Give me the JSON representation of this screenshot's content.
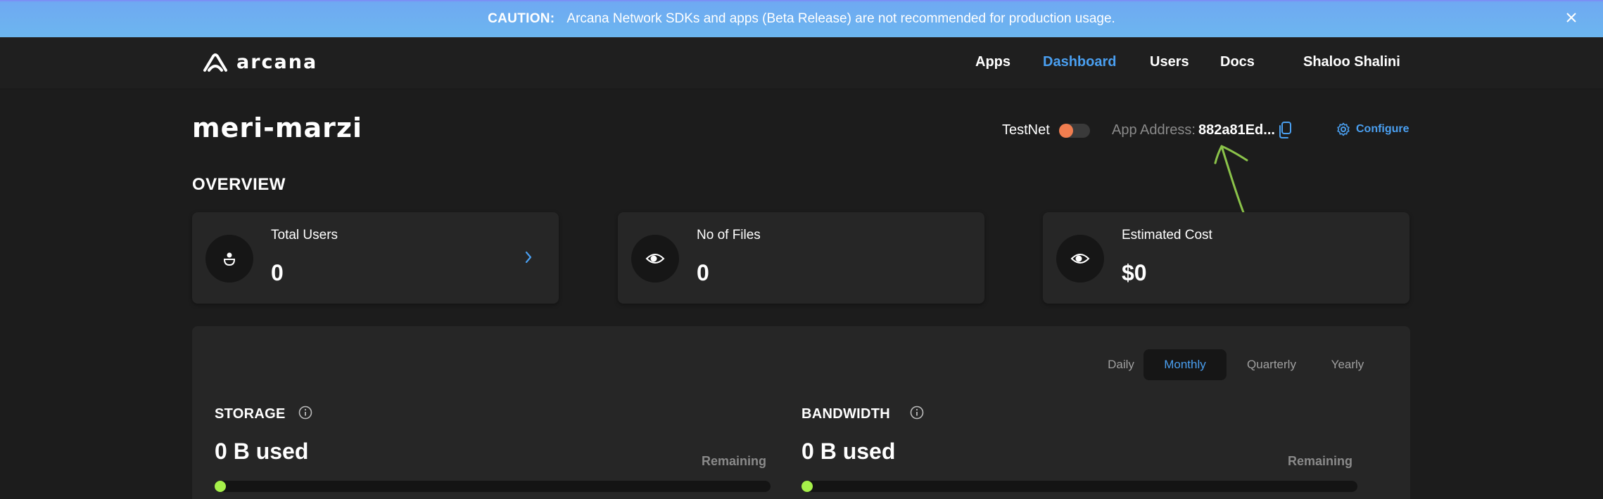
{
  "banner": {
    "caution_label": "CAUTION:",
    "message": "Arcana Network SDKs and apps (Beta Release) are not recommended for production usage."
  },
  "header": {
    "logo_text": "arcana",
    "nav": [
      "Apps",
      "Dashboard",
      "Users",
      "Docs"
    ],
    "active_nav": "Dashboard",
    "user_name": "Shaloo Shalini"
  },
  "app": {
    "title": "meri-marzi",
    "network_label": "TestNet",
    "network_toggle_on": false,
    "address_label": "App Address:",
    "address_value": "882a81Ed...",
    "configure_label": "Configure"
  },
  "overview": {
    "title": "OVERVIEW",
    "cards": [
      {
        "label": "Total Users",
        "value": "0",
        "icon": "user-icon"
      },
      {
        "label": "No of Files",
        "value": "0",
        "icon": "eye-icon"
      },
      {
        "label": "Estimated Cost",
        "value": "$0",
        "icon": "eye-icon"
      }
    ]
  },
  "usage": {
    "periods": [
      "Daily",
      "Monthly",
      "Quarterly",
      "Yearly"
    ],
    "active_period": "Monthly",
    "storage": {
      "title": "STORAGE",
      "used": "0 B used",
      "remaining_label": "Remaining",
      "fill_fraction": 0
    },
    "bandwidth": {
      "title": "BANDWIDTH",
      "used": "0 B used",
      "remaining_label": "Remaining",
      "fill_fraction": 0
    }
  },
  "colors": {
    "accent": "#4a9ff0",
    "toggle_knob": "#f07d4f",
    "progress": "#a6f04a",
    "annotation": "#8bc34a"
  }
}
